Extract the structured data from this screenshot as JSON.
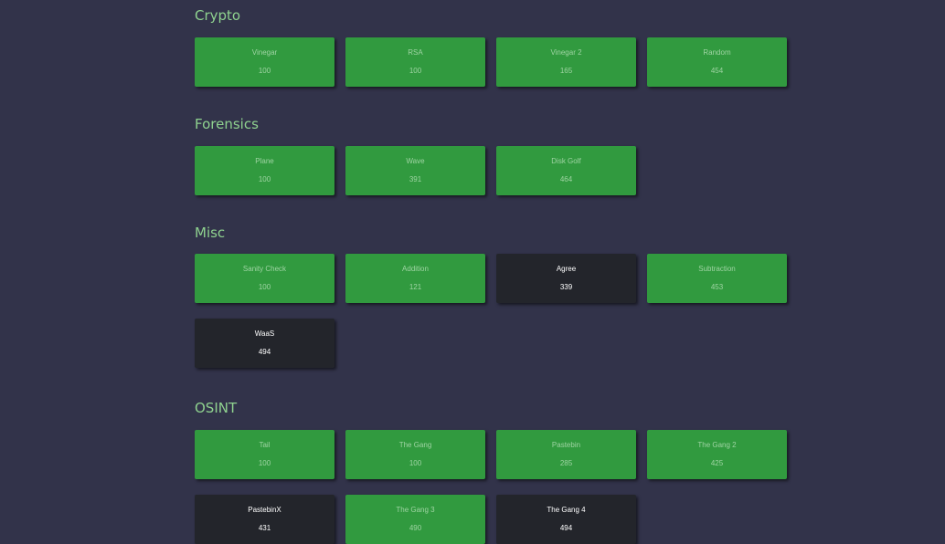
{
  "categories": [
    {
      "title": "Crypto",
      "challenges": [
        {
          "name": "Vinegar",
          "points": "100",
          "solved": false
        },
        {
          "name": "RSA",
          "points": "100",
          "solved": false
        },
        {
          "name": "Vinegar 2",
          "points": "165",
          "solved": false
        },
        {
          "name": "Random",
          "points": "454",
          "solved": false
        }
      ]
    },
    {
      "title": "Forensics",
      "challenges": [
        {
          "name": "Plane",
          "points": "100",
          "solved": false
        },
        {
          "name": "Wave",
          "points": "391",
          "solved": false
        },
        {
          "name": "Disk Golf",
          "points": "464",
          "solved": false
        }
      ]
    },
    {
      "title": "Misc",
      "challenges": [
        {
          "name": "Sanity Check",
          "points": "100",
          "solved": false
        },
        {
          "name": "Addition",
          "points": "121",
          "solved": false
        },
        {
          "name": "Agree",
          "points": "339",
          "solved": true
        },
        {
          "name": "Subtraction",
          "points": "453",
          "solved": false
        },
        {
          "name": "WaaS",
          "points": "494",
          "solved": true
        }
      ]
    },
    {
      "title": "OSINT",
      "challenges": [
        {
          "name": "Tail",
          "points": "100",
          "solved": false
        },
        {
          "name": "The Gang",
          "points": "100",
          "solved": false
        },
        {
          "name": "Pastebin",
          "points": "285",
          "solved": false
        },
        {
          "name": "The Gang 2",
          "points": "425",
          "solved": false
        },
        {
          "name": "PastebinX",
          "points": "431",
          "solved": true
        },
        {
          "name": "The Gang 3",
          "points": "490",
          "solved": false
        },
        {
          "name": "The Gang 4",
          "points": "494",
          "solved": true
        }
      ]
    }
  ],
  "colors": {
    "background": "#32334a",
    "unsolved": "#319a3f",
    "solved": "#23252b",
    "category_title": "#8fd28f"
  }
}
